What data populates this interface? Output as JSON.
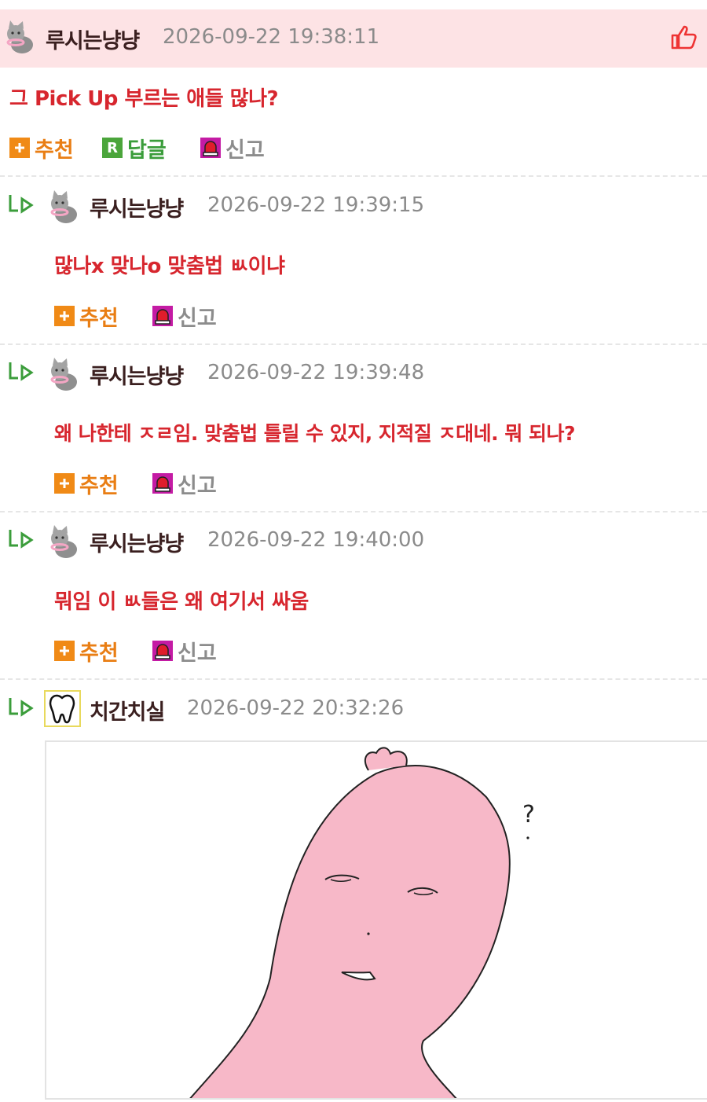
{
  "comments": [
    {
      "nick": "루시는냥냥",
      "time": "2026-09-22 19:38:11",
      "text": "그 Pick Up 부르는 애들 많나?"
    },
    {
      "nick": "루시는냥냥",
      "time": "2026-09-22 19:39:15",
      "text": "많나x 맞나o 맞춤법 ㅄ이냐"
    },
    {
      "nick": "루시는냥냥",
      "time": "2026-09-22 19:39:48",
      "text": "왜 나한테 ㅈㄹ임. 맞춤법 틀릴 수 있지, 지적질 ㅈ대네. 뭐 되나?"
    },
    {
      "nick": "루시는냥냥",
      "time": "2026-09-22 19:40:00",
      "text": "뭐임 이 ㅄ들은 왜 여기서 싸움"
    },
    {
      "nick": "치간치실",
      "time": "2026-09-22 20:32:26",
      "text": ""
    }
  ],
  "actions": {
    "recommend": "추천",
    "reply": "답글",
    "report": "신고"
  },
  "image": {
    "caption_mark": "?"
  },
  "colors": {
    "highlight_bg": "#fde3e5",
    "comment_text": "#d7262e",
    "recommend": "#e97e14",
    "reply": "#3b9d3b"
  }
}
